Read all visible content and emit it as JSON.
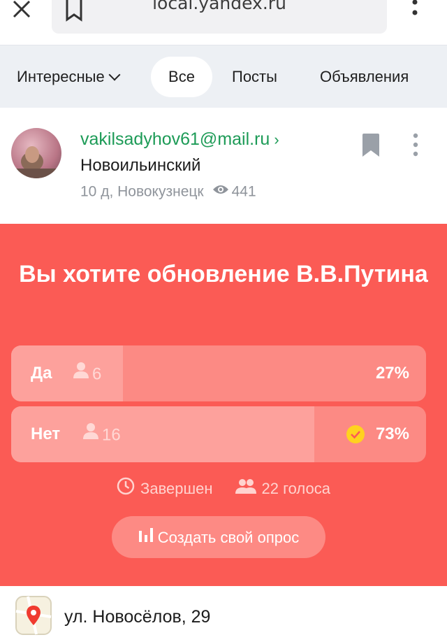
{
  "browser": {
    "url": "local.yandex.ru"
  },
  "tabs": [
    {
      "label": "Интересные",
      "active": false,
      "has_dropdown": true
    },
    {
      "label": "Все",
      "active": true
    },
    {
      "label": "Посты",
      "active": false
    },
    {
      "label": "Объявления",
      "active": false
    }
  ],
  "post": {
    "author": "vakilsadyhov61@mail.ru",
    "author_arrow": "›",
    "location": "Новоильинский",
    "time_place": "10 д, Новокузнецк",
    "views": "441"
  },
  "poll": {
    "title": "Вы хотите обновление В.В.Путина",
    "options": [
      {
        "label": "Да",
        "votes": "6",
        "percent": "27%",
        "share": 0.27,
        "chosen": false
      },
      {
        "label": "Нет",
        "votes": "16",
        "percent": "73%",
        "share": 0.73,
        "chosen": true
      }
    ],
    "status": "Завершен",
    "total_votes": "22 голоса",
    "create_button": "Создать свой опрос"
  },
  "address": {
    "text": "ул. Новосёлов, 29"
  },
  "colors": {
    "poll_bg": "#fb5b55",
    "author_link": "#1d9b57",
    "check": "#ffd21f"
  },
  "icons": [
    "close-icon",
    "bookmark-icon",
    "more-vertical-icon",
    "chevron-down-icon",
    "eye-icon",
    "user-icon",
    "check-circle-icon",
    "clock-icon",
    "users-icon",
    "bar-chart-icon",
    "map-pin-icon"
  ]
}
